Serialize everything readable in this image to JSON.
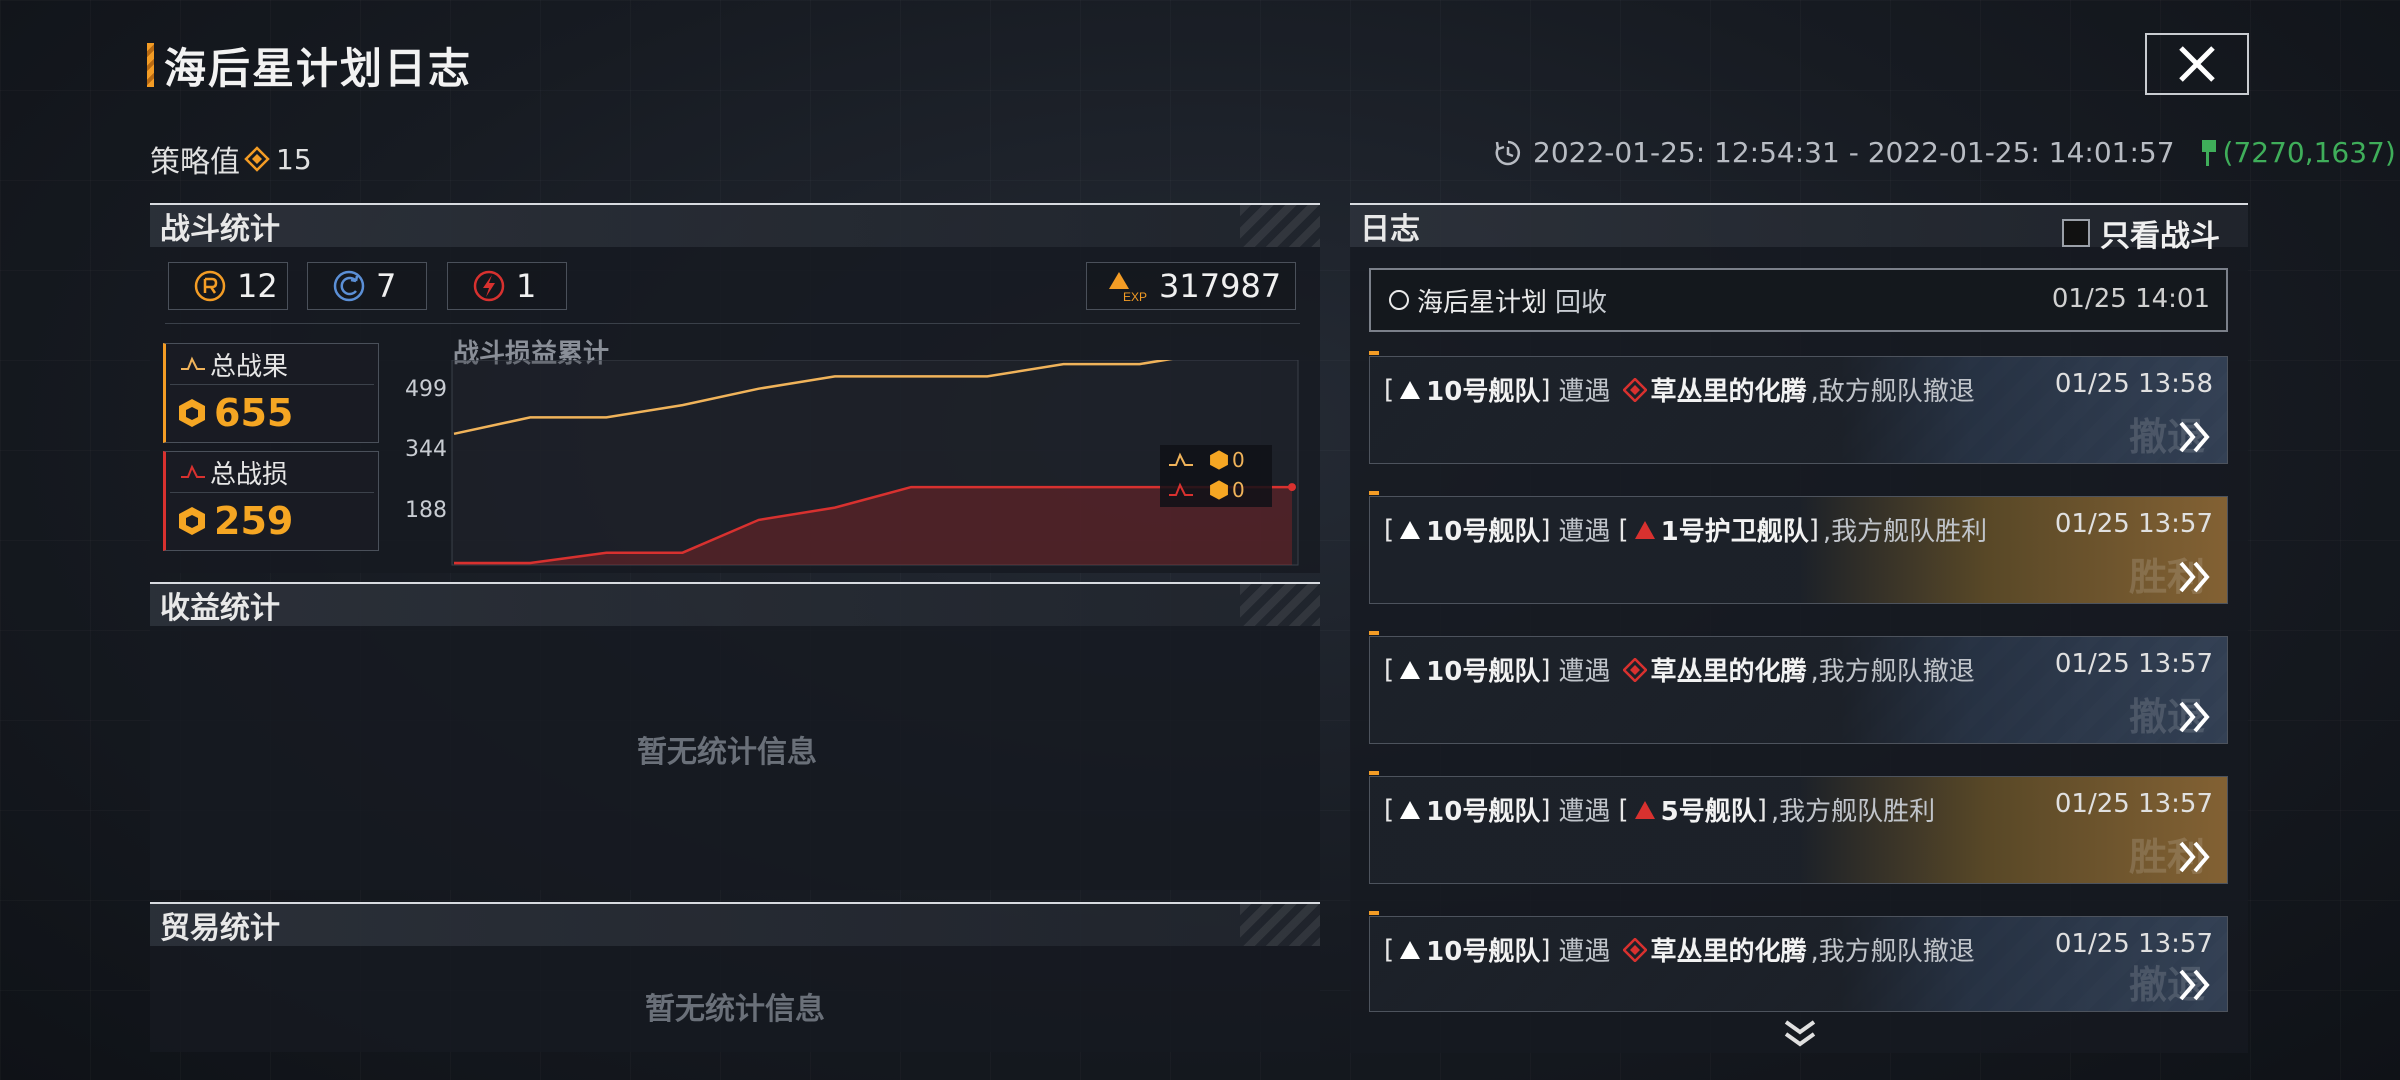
{
  "header": {
    "title": "海后星计划日志",
    "close_icon": "close-icon"
  },
  "strategy": {
    "label": "策略值",
    "value": "15",
    "icon": "diamond-icon"
  },
  "time_range": {
    "text": "2022-01-25: 12:54:31 - 2022-01-25: 14:01:57",
    "coords": "(7270,1637)"
  },
  "battle": {
    "title": "战斗统计",
    "stats": [
      {
        "icon": "pvp-icon",
        "value": "12"
      },
      {
        "icon": "retreat-icon",
        "value": "7"
      },
      {
        "icon": "lightning-icon",
        "value": "1"
      }
    ],
    "exp_label": "EXP",
    "exp": "317987",
    "total_gain_label": "总战果",
    "total_gain": "655",
    "total_loss_label": "总战损",
    "total_loss": "259",
    "chart_title": "战斗损益累计",
    "legend_gain": "0",
    "legend_loss": "0"
  },
  "chart_data": {
    "type": "line",
    "title": "战斗损益累计",
    "yticks": [
      "499",
      "344",
      "188"
    ],
    "ylim": [
      30,
      530
    ],
    "x": [
      0,
      1,
      2,
      3,
      4,
      5,
      6,
      7,
      8,
      9,
      10,
      11
    ],
    "series": [
      {
        "name": "总战果",
        "color": "#f0b35a",
        "values": [
          350,
          390,
          390,
          420,
          460,
          490,
          490,
          490,
          520,
          520,
          550,
          550
        ]
      },
      {
        "name": "总战损",
        "color": "#d8312f",
        "values": [
          35,
          35,
          60,
          60,
          140,
          170,
          220,
          220,
          220,
          220,
          220,
          220
        ]
      }
    ]
  },
  "income": {
    "title": "收益统计",
    "empty": "暂无统计信息"
  },
  "trade": {
    "title": "贸易统计",
    "empty": "暂无统计信息"
  },
  "log": {
    "title": "日志",
    "filter_label": "只看战斗",
    "first": {
      "text": "海后星计划",
      "action": "回收",
      "time": "01/25 14:01"
    },
    "entries": [
      {
        "fleet": "10号舰队",
        "verb": "遭遇",
        "enemy": "草丛里的化腾",
        "enemy_type": "npc",
        "result": ",敌方舰队撤退",
        "time": "01/25 13:58",
        "ghost": "撤退",
        "style": "retreat"
      },
      {
        "fleet": "10号舰队",
        "verb": "遭遇",
        "enemy": "1号护卫舰队",
        "enemy_type": "player",
        "result": ",我方舰队胜利",
        "time": "01/25 13:57",
        "ghost": "胜利",
        "style": "win"
      },
      {
        "fleet": "10号舰队",
        "verb": "遭遇",
        "enemy": "草丛里的化腾",
        "enemy_type": "npc",
        "result": ",我方舰队撤退",
        "time": "01/25 13:57",
        "ghost": "撤退",
        "style": "retreat"
      },
      {
        "fleet": "10号舰队",
        "verb": "遭遇",
        "enemy": "5号舰队",
        "enemy_type": "player",
        "result": ",我方舰队胜利",
        "time": "01/25 13:57",
        "ghost": "胜利",
        "style": "win"
      },
      {
        "fleet": "10号舰队",
        "verb": "遭遇",
        "enemy": "草丛里的化腾",
        "enemy_type": "npc",
        "result": ",我方舰队撤退",
        "time": "01/25 13:57",
        "ghost": "撤退",
        "style": "retreat"
      }
    ]
  }
}
